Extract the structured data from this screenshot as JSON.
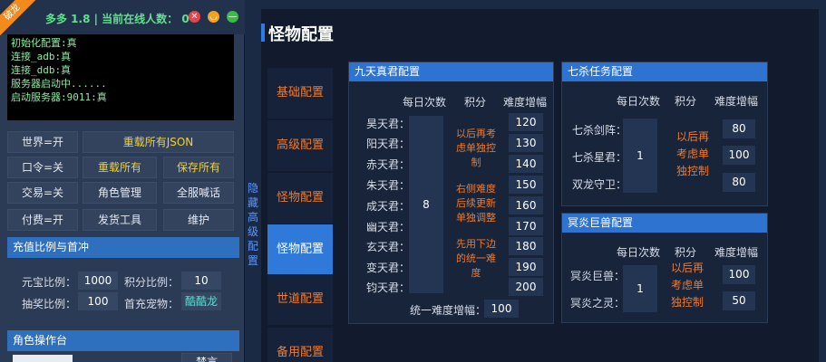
{
  "app": {
    "badge": "破龙",
    "title": "多多 1.8 | 当前在线人数： 0",
    "close_glyph": "✕",
    "min_glyph": "◡",
    "max_glyph": "—"
  },
  "console": {
    "lines": [
      "初始化配置:真",
      "连接_adb:真",
      "连接_ddb:真",
      "服务器启动中......",
      "启动服务器:9011:真"
    ]
  },
  "controls": {
    "world": "世界=开",
    "reload_all_json": "重载所有JSON",
    "command": "口令=关",
    "reload_all": "重载所有",
    "save_all": "保存所有",
    "trade": "交易=关",
    "role_manage": "角色管理",
    "server_shout": "全服喊话",
    "pay": "付费=开",
    "give_tool": "发货工具",
    "maintain": "维护"
  },
  "recharge": {
    "header": "充值比例与首冲",
    "yuanbao_label": "元宝比例：",
    "yuanbao_value": "1000",
    "points_label": "积分比例：",
    "points_value": "10",
    "lottery_label": "抽奖比例：",
    "lottery_value": "100",
    "pet_label": "首充宠物：",
    "pet_value": "酷酷龙"
  },
  "role_console": {
    "header": "角色操作台",
    "ban_label": "禁言"
  },
  "vertical_label": "隐藏高级配置",
  "main": {
    "title": "怪物配置",
    "nav": [
      "基础配置",
      "高级配置",
      "怪物配置",
      "怪物配置",
      "世道配置",
      "备用配置"
    ]
  },
  "jiutian": {
    "header": "九天真君配置",
    "col_daily": "每日次数",
    "col_points": "积分",
    "col_growth": "难度增幅",
    "rows": [
      {
        "name": "昊天君：",
        "growth": "120"
      },
      {
        "name": "阳天君：",
        "growth": "130"
      },
      {
        "name": "赤天君：",
        "growth": "140"
      },
      {
        "name": "朱天君：",
        "growth": "150"
      },
      {
        "name": "成天君：",
        "growth": "160"
      },
      {
        "name": "幽天君：",
        "growth": "170"
      },
      {
        "name": "玄天君：",
        "growth": "180"
      },
      {
        "name": "变天君：",
        "growth": "190"
      },
      {
        "name": "钧天君：",
        "growth": "200"
      }
    ],
    "daily_value": "8",
    "note1": [
      "以后再考",
      "虑单独控",
      "制"
    ],
    "note2": [
      "右侧难度",
      "后续更新",
      "单独调整"
    ],
    "note3": [
      "先用下边",
      "的统一难",
      "度"
    ],
    "unified_label": "统一难度增幅：",
    "unified_value": "100"
  },
  "qisha": {
    "header": "七杀任务配置",
    "col_daily": "每日次数",
    "col_points": "积分",
    "col_growth": "难度增幅",
    "rows": [
      {
        "name": "七杀剑阵：",
        "growth": "80"
      },
      {
        "name": "七杀星君：",
        "growth": "100"
      },
      {
        "name": "双龙守卫：",
        "growth": "80"
      }
    ],
    "daily_value": "1",
    "note": [
      "以后再",
      "考虑单",
      "独控制"
    ]
  },
  "mingyan": {
    "header": "冥炎巨兽配置",
    "col_daily": "每日次数",
    "col_points": "积分",
    "col_growth": "难度增幅",
    "rows": [
      {
        "name": "冥炎巨兽：",
        "growth": "100"
      },
      {
        "name": "冥炎之灵：",
        "growth": "50"
      }
    ],
    "daily_value": "1",
    "note": [
      "以后再",
      "考虑单",
      "独控制"
    ]
  }
}
